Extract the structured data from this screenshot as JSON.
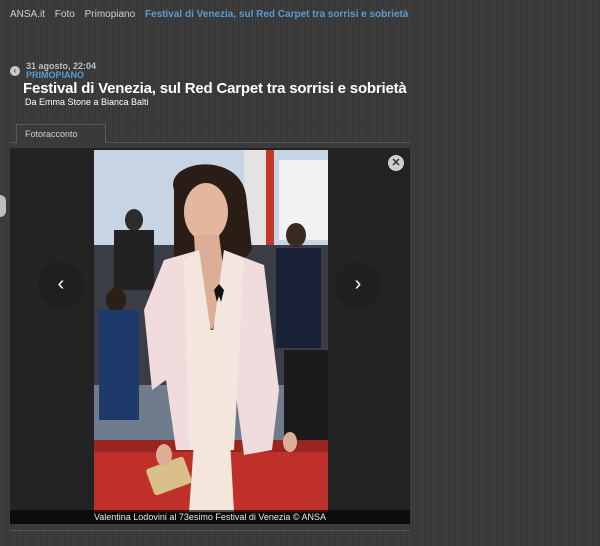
{
  "breadcrumb": {
    "items": [
      "ANSA.it",
      "Foto",
      "Primopiano"
    ],
    "current": "Festival di Venezia, sul Red Carpet tra sorrisi e sobrietà"
  },
  "article": {
    "date": "31 agosto, 22:04",
    "category": "PRIMOPIANO",
    "title": "Festival di Venezia, sul Red Carpet tra sorrisi e sobrietà",
    "subtitle": "Da Emma Stone a Bianca Balti"
  },
  "tabs": {
    "active": "Fotoracconto"
  },
  "gallery": {
    "caption": "Valentina Lodovini al 73esimo Festival di Venezia © ANSA",
    "prev_icon": "chevron-left-icon",
    "next_icon": "chevron-right-icon",
    "close_icon": "close-icon"
  },
  "colors": {
    "accent": "#5c9bd1",
    "background": "#3a3a3a",
    "gallery_bg": "#232323"
  }
}
